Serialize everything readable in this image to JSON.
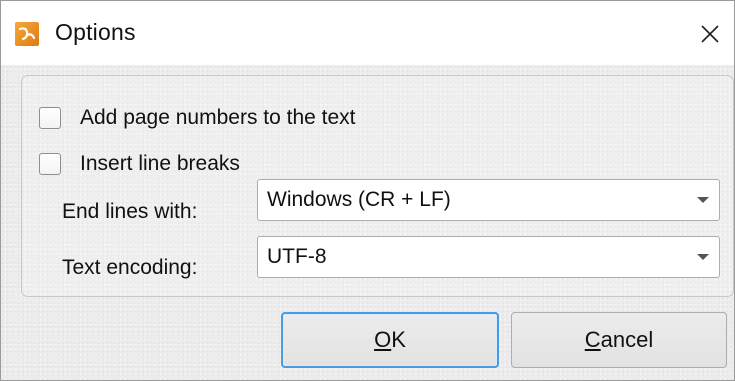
{
  "window": {
    "title": "Options",
    "icon": "pdf-xchange-app-icon",
    "close_icon": "close-icon"
  },
  "options": {
    "add_page_numbers": {
      "label": "Add page numbers to the text",
      "checked": false
    },
    "insert_line_breaks": {
      "label": "Insert line breaks",
      "checked": false
    }
  },
  "end_lines": {
    "label": "End lines with:",
    "value": "Windows (CR + LF)"
  },
  "text_encoding": {
    "label": "Text encoding:",
    "value": "UTF-8"
  },
  "buttons": {
    "ok": {
      "mnemonic": "O",
      "rest": "K"
    },
    "cancel": {
      "mnemonic": "C",
      "rest": "ancel"
    }
  },
  "colors": {
    "dialog_background": "#ececec",
    "default_button_border": "#4a9be0",
    "app_icon": "#e88a1c"
  }
}
